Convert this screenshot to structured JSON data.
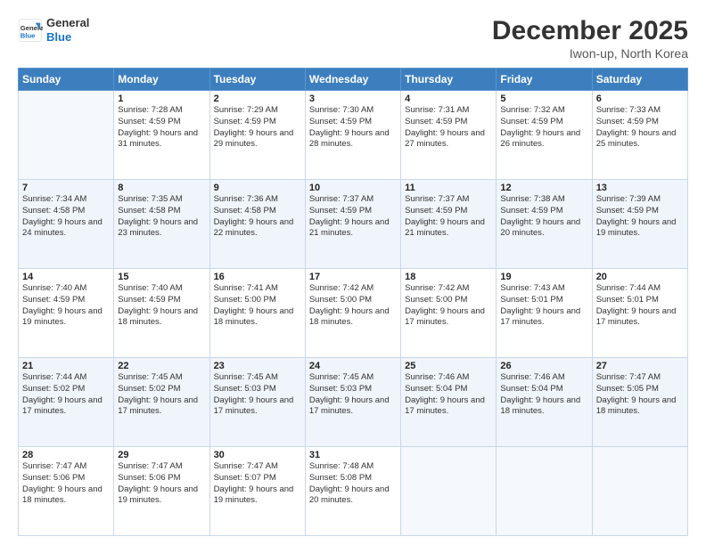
{
  "header": {
    "logo_line1": "General",
    "logo_line2": "Blue",
    "month_year": "December 2025",
    "location": "Iwon-up, North Korea"
  },
  "days_of_week": [
    "Sunday",
    "Monday",
    "Tuesday",
    "Wednesday",
    "Thursday",
    "Friday",
    "Saturday"
  ],
  "weeks": [
    [
      {
        "day": "",
        "empty": true
      },
      {
        "day": "1",
        "sunrise": "7:28 AM",
        "sunset": "4:59 PM",
        "daylight": "9 hours and 31 minutes."
      },
      {
        "day": "2",
        "sunrise": "7:29 AM",
        "sunset": "4:59 PM",
        "daylight": "9 hours and 29 minutes."
      },
      {
        "day": "3",
        "sunrise": "7:30 AM",
        "sunset": "4:59 PM",
        "daylight": "9 hours and 28 minutes."
      },
      {
        "day": "4",
        "sunrise": "7:31 AM",
        "sunset": "4:59 PM",
        "daylight": "9 hours and 27 minutes."
      },
      {
        "day": "5",
        "sunrise": "7:32 AM",
        "sunset": "4:59 PM",
        "daylight": "9 hours and 26 minutes."
      },
      {
        "day": "6",
        "sunrise": "7:33 AM",
        "sunset": "4:59 PM",
        "daylight": "9 hours and 25 minutes."
      }
    ],
    [
      {
        "day": "7",
        "sunrise": "7:34 AM",
        "sunset": "4:58 PM",
        "daylight": "9 hours and 24 minutes."
      },
      {
        "day": "8",
        "sunrise": "7:35 AM",
        "sunset": "4:58 PM",
        "daylight": "9 hours and 23 minutes."
      },
      {
        "day": "9",
        "sunrise": "7:36 AM",
        "sunset": "4:58 PM",
        "daylight": "9 hours and 22 minutes."
      },
      {
        "day": "10",
        "sunrise": "7:37 AM",
        "sunset": "4:59 PM",
        "daylight": "9 hours and 21 minutes."
      },
      {
        "day": "11",
        "sunrise": "7:37 AM",
        "sunset": "4:59 PM",
        "daylight": "9 hours and 21 minutes."
      },
      {
        "day": "12",
        "sunrise": "7:38 AM",
        "sunset": "4:59 PM",
        "daylight": "9 hours and 20 minutes."
      },
      {
        "day": "13",
        "sunrise": "7:39 AM",
        "sunset": "4:59 PM",
        "daylight": "9 hours and 19 minutes."
      }
    ],
    [
      {
        "day": "14",
        "sunrise": "7:40 AM",
        "sunset": "4:59 PM",
        "daylight": "9 hours and 19 minutes."
      },
      {
        "day": "15",
        "sunrise": "7:40 AM",
        "sunset": "4:59 PM",
        "daylight": "9 hours and 18 minutes."
      },
      {
        "day": "16",
        "sunrise": "7:41 AM",
        "sunset": "5:00 PM",
        "daylight": "9 hours and 18 minutes."
      },
      {
        "day": "17",
        "sunrise": "7:42 AM",
        "sunset": "5:00 PM",
        "daylight": "9 hours and 18 minutes."
      },
      {
        "day": "18",
        "sunrise": "7:42 AM",
        "sunset": "5:00 PM",
        "daylight": "9 hours and 17 minutes."
      },
      {
        "day": "19",
        "sunrise": "7:43 AM",
        "sunset": "5:01 PM",
        "daylight": "9 hours and 17 minutes."
      },
      {
        "day": "20",
        "sunrise": "7:44 AM",
        "sunset": "5:01 PM",
        "daylight": "9 hours and 17 minutes."
      }
    ],
    [
      {
        "day": "21",
        "sunrise": "7:44 AM",
        "sunset": "5:02 PM",
        "daylight": "9 hours and 17 minutes."
      },
      {
        "day": "22",
        "sunrise": "7:45 AM",
        "sunset": "5:02 PM",
        "daylight": "9 hours and 17 minutes."
      },
      {
        "day": "23",
        "sunrise": "7:45 AM",
        "sunset": "5:03 PM",
        "daylight": "9 hours and 17 minutes."
      },
      {
        "day": "24",
        "sunrise": "7:45 AM",
        "sunset": "5:03 PM",
        "daylight": "9 hours and 17 minutes."
      },
      {
        "day": "25",
        "sunrise": "7:46 AM",
        "sunset": "5:04 PM",
        "daylight": "9 hours and 17 minutes."
      },
      {
        "day": "26",
        "sunrise": "7:46 AM",
        "sunset": "5:04 PM",
        "daylight": "9 hours and 18 minutes."
      },
      {
        "day": "27",
        "sunrise": "7:47 AM",
        "sunset": "5:05 PM",
        "daylight": "9 hours and 18 minutes."
      }
    ],
    [
      {
        "day": "28",
        "sunrise": "7:47 AM",
        "sunset": "5:06 PM",
        "daylight": "9 hours and 18 minutes."
      },
      {
        "day": "29",
        "sunrise": "7:47 AM",
        "sunset": "5:06 PM",
        "daylight": "9 hours and 19 minutes."
      },
      {
        "day": "30",
        "sunrise": "7:47 AM",
        "sunset": "5:07 PM",
        "daylight": "9 hours and 19 minutes."
      },
      {
        "day": "31",
        "sunrise": "7:48 AM",
        "sunset": "5:08 PM",
        "daylight": "9 hours and 20 minutes."
      },
      {
        "day": "",
        "empty": true
      },
      {
        "day": "",
        "empty": true
      },
      {
        "day": "",
        "empty": true
      }
    ]
  ]
}
